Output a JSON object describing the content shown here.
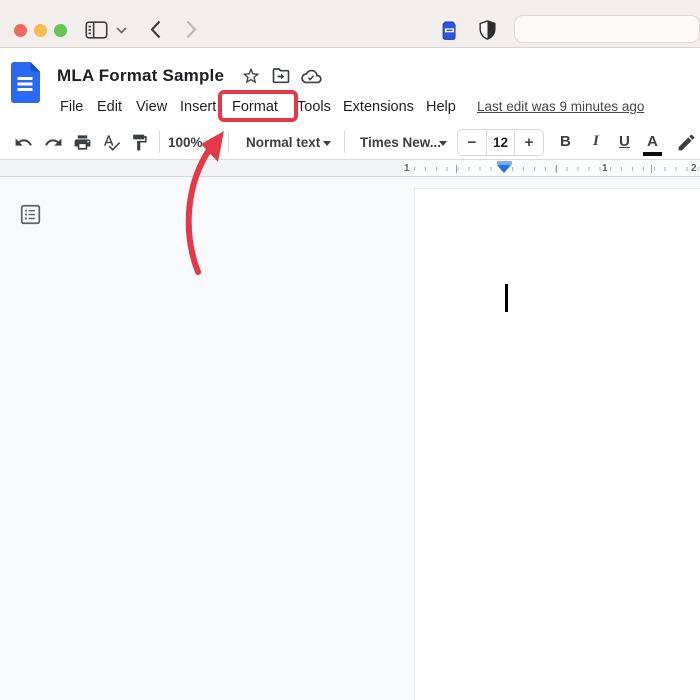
{
  "colors": {
    "annotation_red": "#e5394b",
    "docs_logo_blue": "#2a6af3",
    "indent_marker_blue": "#1a73e8"
  },
  "browser_bar": {
    "address_value": ""
  },
  "header": {
    "doc_title": "MLA Format Sample",
    "menu": [
      "File",
      "Edit",
      "View",
      "Insert",
      "Format",
      "Tools",
      "Extensions",
      "Help"
    ],
    "highlighted_menu_item": "Format",
    "last_edit_status": "Last edit was 9 minutes ago"
  },
  "toolbar": {
    "zoom": "100%",
    "paragraph_style": "Normal text",
    "font": "Times New...",
    "font_size": "12",
    "minus": "−",
    "plus": "+",
    "bold": "B",
    "italic": "I",
    "underline": "U",
    "text_color": "A"
  },
  "ruler": {
    "labels": [
      "1",
      "1",
      "2"
    ]
  }
}
